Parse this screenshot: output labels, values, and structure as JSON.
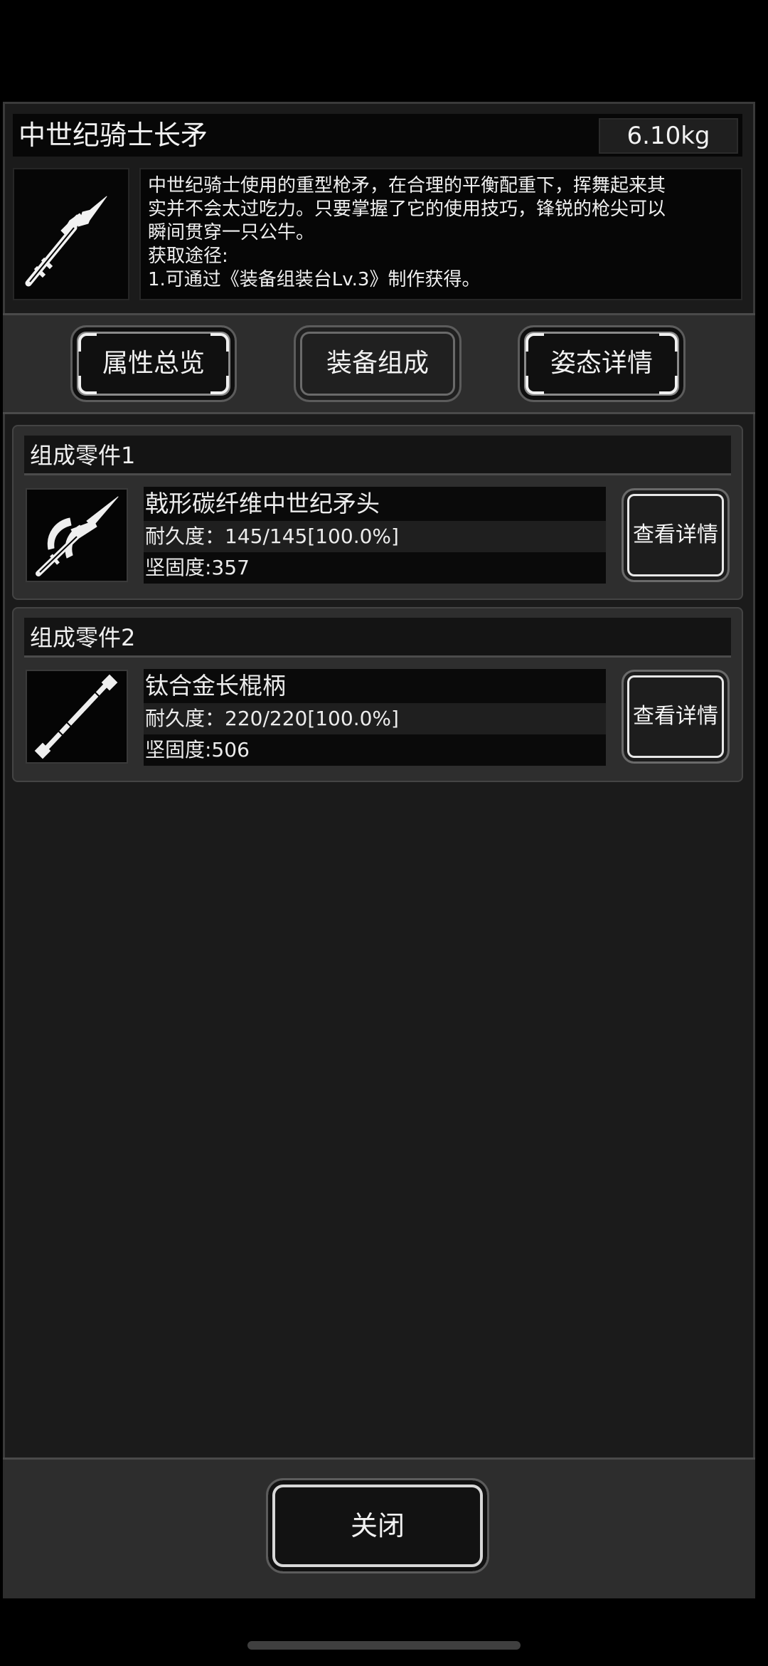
{
  "item": {
    "title": "中世纪骑士长矛",
    "weight": "6.10kg",
    "icon": "spear-icon",
    "description_lines": [
      "中世纪骑士使用的重型枪矛，在合理的平衡配重下，挥舞起来其",
      "实并不会太过吃力。只要掌握了它的使用技巧，锋锐的枪尖可以",
      "瞬间贯穿一只公牛。",
      "获取途径:",
      "1.可通过《装备组装台Lv.3》制作获得。"
    ]
  },
  "tabs": [
    {
      "label": "属性总览",
      "active": false
    },
    {
      "label": "装备组成",
      "active": true
    },
    {
      "label": "姿态详情",
      "active": false
    }
  ],
  "components": [
    {
      "header": "组成零件1",
      "icon": "halberd-head-icon",
      "name": "戟形碳纤维中世纪矛头",
      "durability": "耐久度：145/145[100.0%]",
      "hardness": "坚固度:357",
      "button": "查看详情"
    },
    {
      "header": "组成零件2",
      "icon": "staff-handle-icon",
      "name": "钛合金长棍柄",
      "durability": "耐久度：220/220[100.0%]",
      "hardness": "坚固度:506",
      "button": "查看详情"
    }
  ],
  "close_label": "关闭",
  "colors": {
    "panel_bg": "#1b1b1b",
    "bar_bg": "#2d2d2d",
    "text": "#ececec"
  }
}
